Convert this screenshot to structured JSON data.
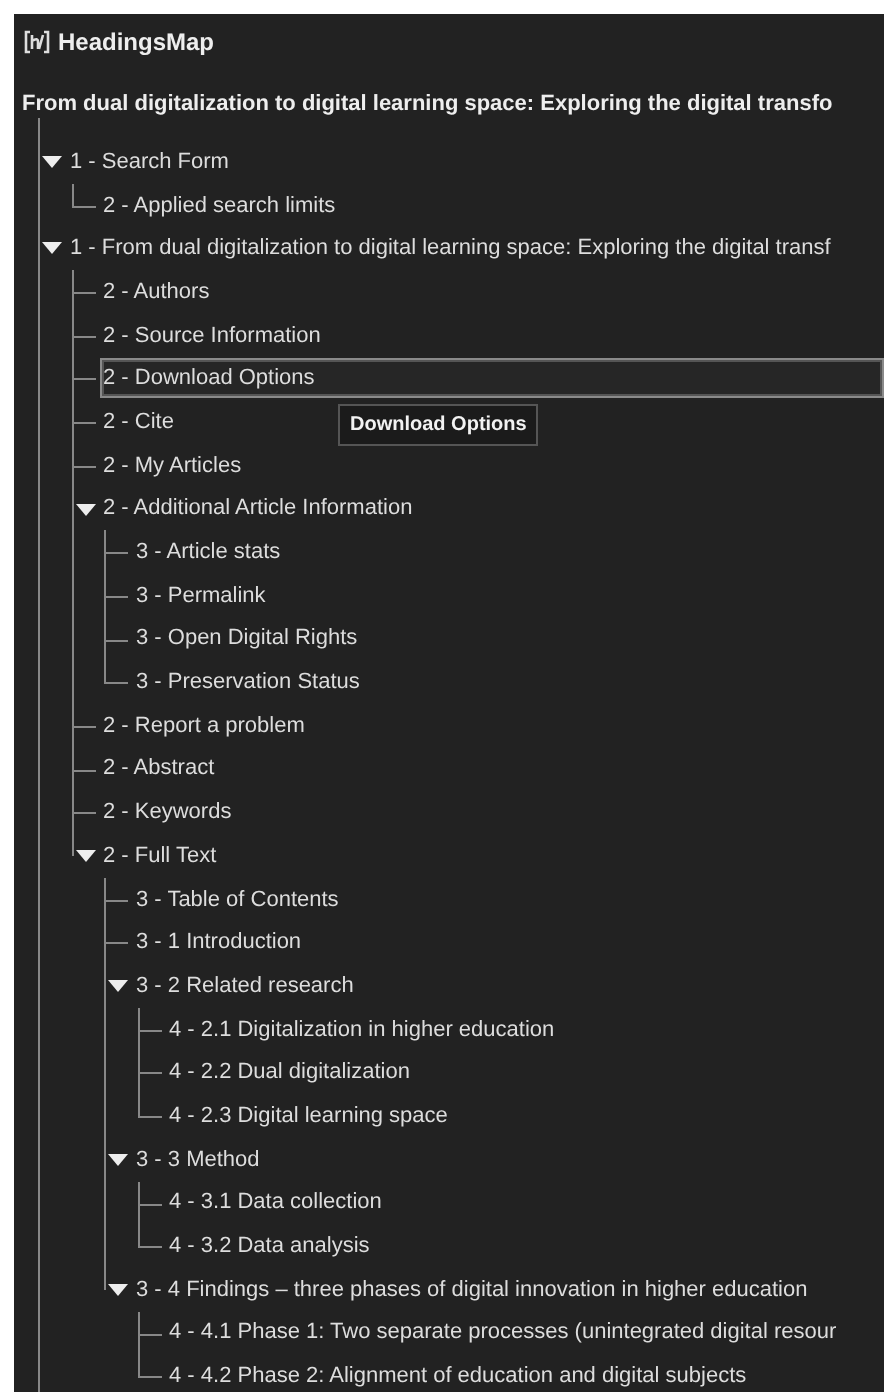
{
  "app": {
    "title": "HeadingsMap"
  },
  "document_title": "From dual digitalization to digital learning space: Exploring the digital transfo",
  "tree": [
    {
      "label": "1 - Search Form",
      "selected": false,
      "expanded": true,
      "children": [
        {
          "label": "2 - Applied search limits",
          "selected": false
        }
      ]
    },
    {
      "label": "1 - From dual digitalization to digital learning space: Exploring the digital transf",
      "selected": false,
      "expanded": true,
      "children": [
        {
          "label": "2 - Authors",
          "selected": false
        },
        {
          "label": "2 - Source Information",
          "selected": false
        },
        {
          "label": "2 - Download Options",
          "selected": true
        },
        {
          "label": "2 - Cite",
          "selected": false
        },
        {
          "label": "2 - My Articles",
          "selected": false
        },
        {
          "label": "2 - Additional Article Information",
          "selected": false,
          "expanded": true,
          "children": [
            {
              "label": "3 - Article stats",
              "selected": false
            },
            {
              "label": "3 - Permalink",
              "selected": false
            },
            {
              "label": "3 - Open Digital Rights",
              "selected": false
            },
            {
              "label": "3 - Preservation Status",
              "selected": false
            }
          ]
        },
        {
          "label": "2 - Report a problem",
          "selected": false
        },
        {
          "label": "2 - Abstract",
          "selected": false
        },
        {
          "label": "2 - Keywords",
          "selected": false
        },
        {
          "label": "2 - Full Text",
          "selected": false,
          "expanded": true,
          "children": [
            {
              "label": "3 - Table of Contents",
              "selected": false
            },
            {
              "label": "3 - 1 Introduction",
              "selected": false
            },
            {
              "label": "3 - 2 Related research",
              "selected": false,
              "expanded": true,
              "children": [
                {
                  "label": "4 - 2.1 Digitalization in higher education",
                  "selected": false
                },
                {
                  "label": "4 - 2.2 Dual digitalization",
                  "selected": false
                },
                {
                  "label": "4 - 2.3 Digital learning space",
                  "selected": false
                }
              ]
            },
            {
              "label": "3 - 3 Method",
              "selected": false,
              "expanded": true,
              "children": [
                {
                  "label": "4 - 3.1 Data collection",
                  "selected": false
                },
                {
                  "label": "4 - 3.2 Data analysis",
                  "selected": false
                }
              ]
            },
            {
              "label": "3 - 4 Findings – three phases of digital innovation in higher education",
              "selected": false,
              "expanded": true,
              "children": [
                {
                  "label": "4 - 4.1 Phase 1: Two separate processes (unintegrated digital resour",
                  "selected": false
                },
                {
                  "label": "4 - 4.2 Phase 2: Alignment of education and digital subjects",
                  "selected": false
                }
              ]
            }
          ]
        }
      ]
    }
  ],
  "tooltip": {
    "text": "Download Options"
  }
}
